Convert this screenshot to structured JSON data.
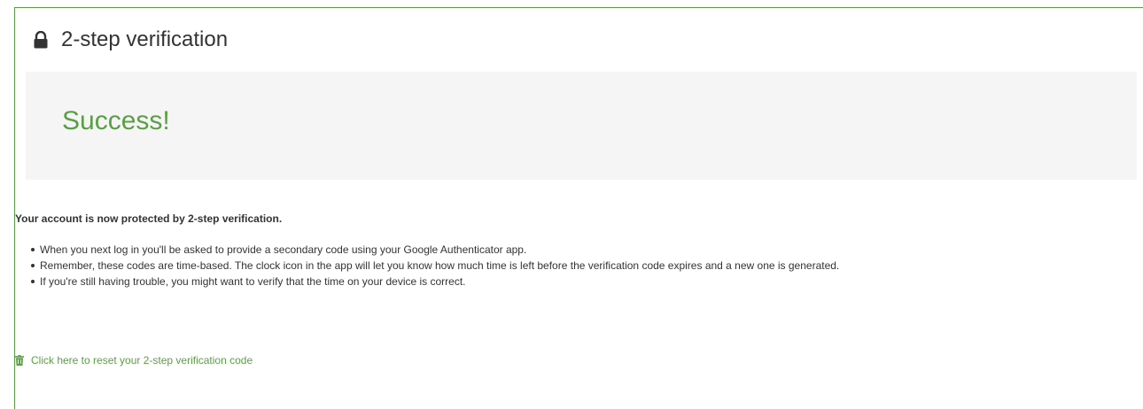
{
  "panel": {
    "title": "2-step verification",
    "title_icon": "lock-icon"
  },
  "success": {
    "heading": "Success!"
  },
  "content": {
    "lead": "Your account is now protected by 2-step verification.",
    "bullets": [
      "When you next log in you'll be asked to provide a secondary code using your Google Authenticator app.",
      "Remember, these codes are time-based. The clock icon in the app will let you know how much time is left before the verification code expires and a new one is generated.",
      "If you're still having trouble, you might want to verify that the time on your device is correct."
    ]
  },
  "reset_link": {
    "label": "Click here to reset your 2-step verification code",
    "icon": "trash-icon"
  },
  "colors": {
    "accent": "#5a9f44",
    "text": "#333333",
    "success_bg": "#f5f5f5"
  }
}
